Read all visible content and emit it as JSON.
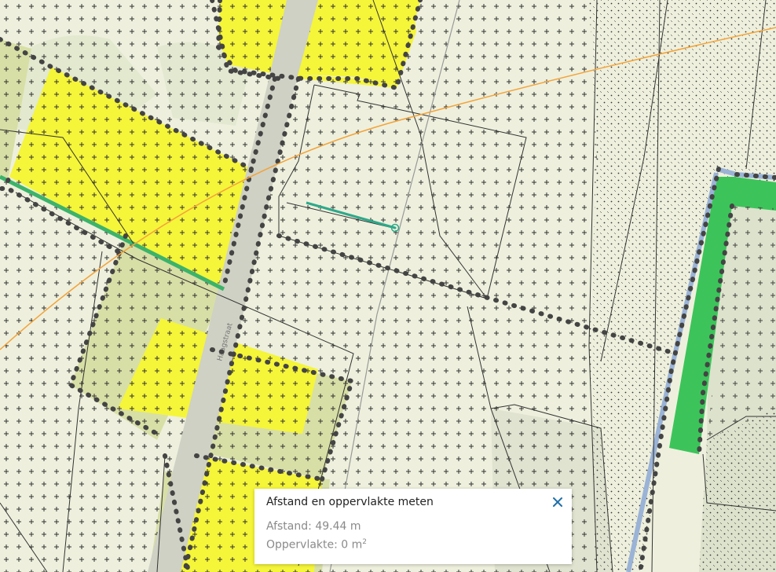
{
  "map": {
    "street_label": "Haagstraat",
    "colors": {
      "background": "#eef0dd",
      "yellow_zone": "#f5f53a",
      "olive_zone": "#d8dfa6",
      "green_zone": "#3cc45a",
      "road": "#cfd1c4",
      "orange_line": "#f3a33a",
      "measure_line": "#2ea98a"
    }
  },
  "measure_panel": {
    "title": "Afstand en oppervlakte meten",
    "distance_label": "Afstand:",
    "distance_value": "49.44 m",
    "area_label": "Oppervlakte:",
    "area_value": "0 m",
    "area_unit_sup": "2",
    "close_icon": "close-icon"
  }
}
